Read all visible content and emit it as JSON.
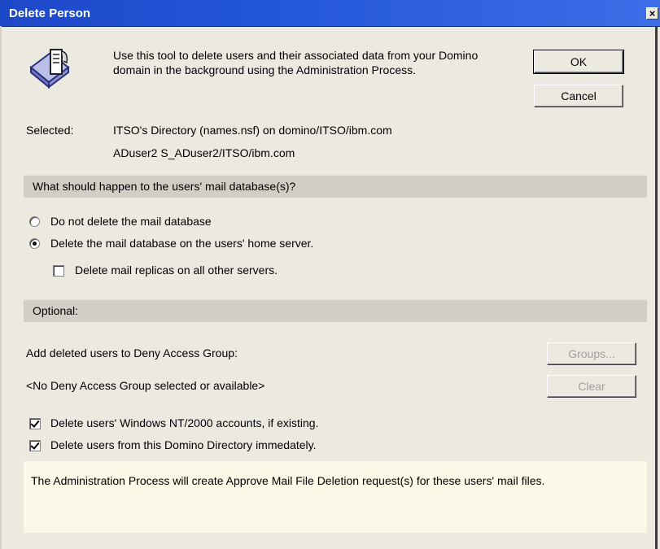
{
  "window": {
    "title": "Delete Person",
    "close_glyph": "×"
  },
  "intro": {
    "icon": "delete-person-document-icon",
    "text": "Use this tool to delete users and their associated data from your Domino domain in the background using the Administration Process."
  },
  "buttons": {
    "ok": "OK",
    "cancel": "Cancel",
    "groups": "Groups...",
    "clear": "Clear"
  },
  "selected": {
    "label": "Selected:",
    "directory": "ITSO's Directory (names.nsf) on domino/ITSO/ibm.com",
    "user": "ADuser2 S_ADuser2/ITSO/ibm.com"
  },
  "mail_section": {
    "header": "What should happen to the users' mail database(s)?",
    "options": [
      {
        "label": "Do not delete the mail database",
        "checked": false
      },
      {
        "label": "Delete the mail database on the users' home server.",
        "checked": true
      }
    ],
    "replicas": {
      "label": "Delete mail replicas on all other servers.",
      "checked": false
    }
  },
  "optional_section": {
    "header": "Optional:",
    "deny_group_label": "Add deleted users to Deny Access Group:",
    "deny_group_value": "<No Deny Access Group selected or available>",
    "checkboxes": [
      {
        "label": "Delete users' Windows NT/2000 accounts, if existing.",
        "checked": true
      },
      {
        "label": "Delete users from this Domino Directory immedately.",
        "checked": true
      }
    ]
  },
  "info": {
    "text": "The Administration Process will create Approve Mail File Deletion request(s) for these users' mail files."
  },
  "colors": {
    "titlebar": "#2356d8",
    "dialog_bg": "#ece9e1",
    "section_bg": "#d2cec5",
    "info_bg": "#fbf8e7"
  }
}
